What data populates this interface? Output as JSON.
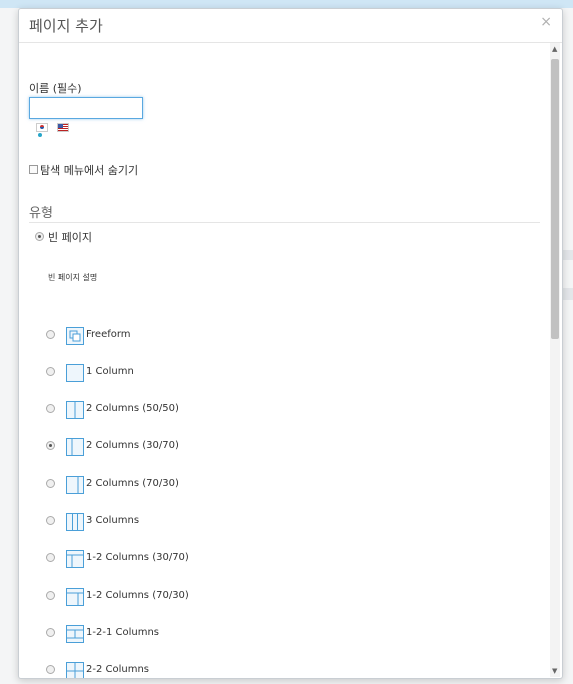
{
  "dialog": {
    "title": "페이지 추가",
    "close": "×"
  },
  "form": {
    "name_label": "이름 (필수)",
    "name_value": "",
    "languages": [
      "ko-flag-icon",
      "en-us-flag-icon"
    ],
    "hide_checkbox_label": "탐색 메뉴에서 숨기기",
    "hide_checked": false
  },
  "type_section": {
    "title": "유형",
    "blank_page_label": "빈 페이지",
    "blank_page_selected": true,
    "blank_page_description": "빈 페이지 설명"
  },
  "layouts": [
    {
      "label": "Freeform",
      "icon": "freeform-layout-icon",
      "selected": false
    },
    {
      "label": "1 Column",
      "icon": "one-column-layout-icon",
      "selected": false
    },
    {
      "label": "2 Columns (50/50)",
      "icon": "two-columns-50-50-layout-icon",
      "selected": false
    },
    {
      "label": "2 Columns (30/70)",
      "icon": "two-columns-30-70-layout-icon",
      "selected": true
    },
    {
      "label": "2 Columns (70/30)",
      "icon": "two-columns-70-30-layout-icon",
      "selected": false
    },
    {
      "label": "3 Columns",
      "icon": "three-columns-layout-icon",
      "selected": false
    },
    {
      "label": "1-2 Columns (30/70)",
      "icon": "one-two-columns-30-70-layout-icon",
      "selected": false
    },
    {
      "label": "1-2 Columns (70/30)",
      "icon": "one-two-columns-70-30-layout-icon",
      "selected": false
    },
    {
      "label": "1-2-1 Columns",
      "icon": "one-two-one-columns-layout-icon",
      "selected": false
    },
    {
      "label": "2-2 Columns",
      "icon": "two-two-columns-layout-icon",
      "selected": false
    }
  ],
  "colors": {
    "accent": "#4a9fd8",
    "input_focus": "#5aa8e0"
  }
}
